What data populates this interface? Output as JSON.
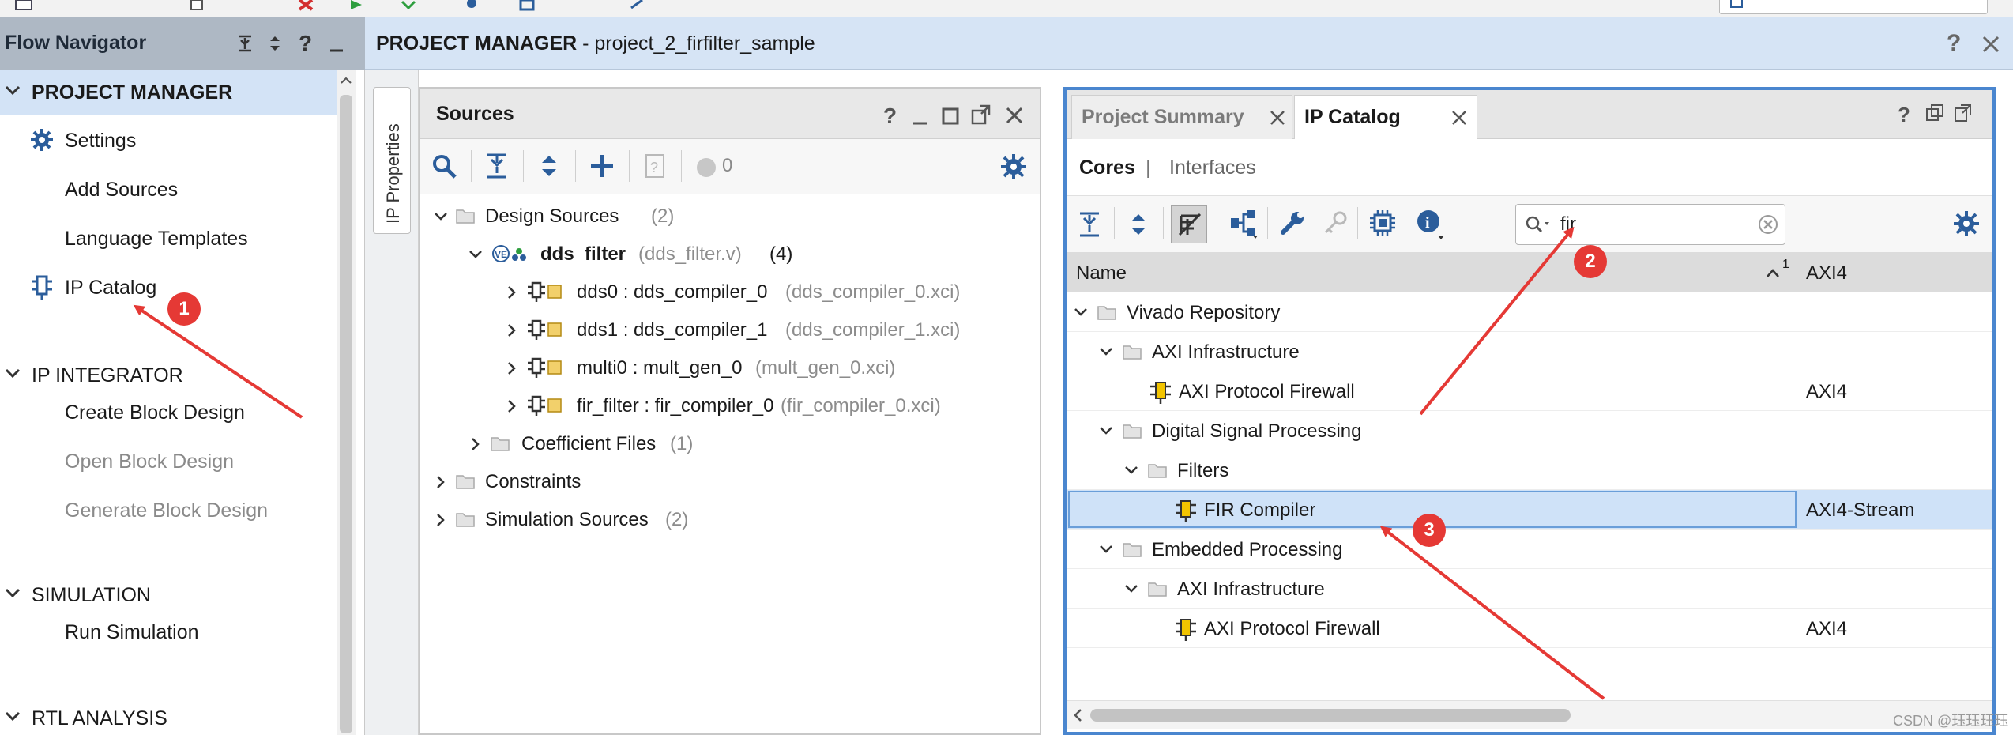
{
  "flow_navigator": {
    "title": "Flow Navigator",
    "sections": [
      {
        "label": "PROJECT MANAGER",
        "items": [
          {
            "label": "Settings"
          },
          {
            "label": "Add Sources"
          },
          {
            "label": "Language Templates"
          },
          {
            "label": "IP Catalog"
          }
        ]
      },
      {
        "label": "IP INTEGRATOR",
        "items": [
          {
            "label": "Create Block Design"
          },
          {
            "label": "Open Block Design"
          },
          {
            "label": "Generate Block Design"
          }
        ]
      },
      {
        "label": "SIMULATION",
        "items": [
          {
            "label": "Run Simulation"
          }
        ]
      },
      {
        "label": "RTL ANALYSIS",
        "items": []
      }
    ]
  },
  "header": {
    "prefix": "PROJECT MANAGER",
    "suffix": " - project_2_firfilter_sample"
  },
  "side_tab": {
    "label": "IP Properties"
  },
  "sources": {
    "title": "Sources",
    "count_badge": "0",
    "tree": {
      "design_sources": {
        "label": "Design Sources",
        "count": "(2)"
      },
      "dds_filter": {
        "label": "dds_filter",
        "file": "(dds_filter.v)",
        "count": "(4)"
      },
      "children": [
        {
          "label": "dds0 : dds_compiler_0",
          "file": "(dds_compiler_0.xci)"
        },
        {
          "label": "dds1 : dds_compiler_1",
          "file": "(dds_compiler_1.xci)"
        },
        {
          "label": "multi0 : mult_gen_0",
          "file": "(mult_gen_0.xci)"
        },
        {
          "label": "fir_filter : fir_compiler_0",
          "file": "(fir_compiler_0.xci)"
        }
      ],
      "coefficient_files": {
        "label": "Coefficient Files",
        "count": "(1)"
      },
      "constraints": {
        "label": "Constraints"
      },
      "simulation_sources": {
        "label": "Simulation Sources",
        "count": "(2)"
      }
    }
  },
  "ip_catalog": {
    "tabs": [
      {
        "label": "Project Summary"
      },
      {
        "label": "IP Catalog"
      }
    ],
    "subtabs": {
      "cores": "Cores",
      "separator": "|",
      "interfaces": "Interfaces"
    },
    "search": {
      "value": "fir"
    },
    "columns": {
      "name": "Name",
      "sort_indicator": "1",
      "interface": "AXI4"
    },
    "rows": [
      {
        "label": "Vivado Repository",
        "interface": ""
      },
      {
        "label": "AXI Infrastructure",
        "interface": ""
      },
      {
        "label": "AXI Protocol Firewall",
        "interface": "AXI4"
      },
      {
        "label": "Digital Signal Processing",
        "interface": ""
      },
      {
        "label": "Filters",
        "interface": ""
      },
      {
        "label": "FIR Compiler",
        "interface": "AXI4-Stream"
      },
      {
        "label": "Embedded Processing",
        "interface": ""
      },
      {
        "label": "AXI Infrastructure",
        "interface": ""
      },
      {
        "label": "AXI Protocol Firewall",
        "interface": "AXI4"
      }
    ]
  },
  "annotations": {
    "marker1": "1",
    "marker2": "2",
    "marker3": "3"
  },
  "watermark": "CSDN @珏珏珏珏",
  "colors": {
    "accent_blue": "#4a86cf",
    "marker_red": "#e53935",
    "header_blue": "#d6e4f5",
    "selection": "#cfe2f8",
    "ip_icon_yellow": "#f2c400"
  }
}
